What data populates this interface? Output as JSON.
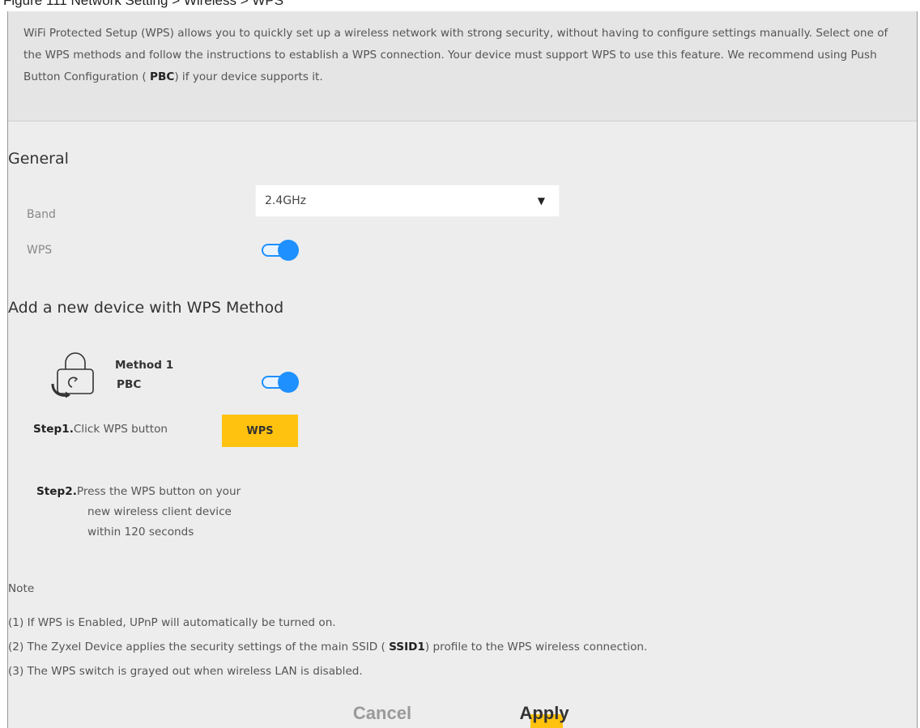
{
  "figure_caption": "Figure 111 Network Setting > Wireless > WPS",
  "intro": {
    "text_before": "WiFi Protected Setup (WPS) allows you to quickly set up a wireless network with strong security, without having to configure settings manually. Select one of the WPS methods and follow the instructions to establish a WPS connection. Your device must support WPS to use this feature. We recommend using Push Button Configuration ( ",
    "bold": "PBC",
    "text_after": ") if your device supports it."
  },
  "general": {
    "title": "General",
    "band_label": "Band",
    "band_value": "2.4GHz",
    "wps_label": "WPS",
    "wps_enabled": true
  },
  "add_device": {
    "title": "Add a new device with WPS Method",
    "method_name": "Method 1",
    "method_type": "PBC",
    "method_enabled": true,
    "step1_label": "Step1.",
    "step1_text": "Click WPS button",
    "wps_button_label": "WPS",
    "step2_label": "Step2.",
    "step2_line1": "Press the WPS button on your",
    "step2_line2": "new wireless client device",
    "step2_line3": "within 120 seconds"
  },
  "note": {
    "title": "Note",
    "line1": "(1) If WPS is Enabled, UPnP will automatically be turned on.",
    "line2_before": "(2) The Zyxel Device applies the security settings of the main SSID ( ",
    "line2_bold": "SSID1",
    "line2_after": ") profile to the WPS wireless connection.",
    "line3": "(3) The WPS switch is grayed out when wireless LAN is disabled."
  },
  "footer": {
    "cancel_label": "Cancel",
    "apply_label": "Apply"
  },
  "colors": {
    "accent_toggle": "#1e90ff",
    "button_yellow": "#ffc20e",
    "panel_bg": "#ededed"
  }
}
